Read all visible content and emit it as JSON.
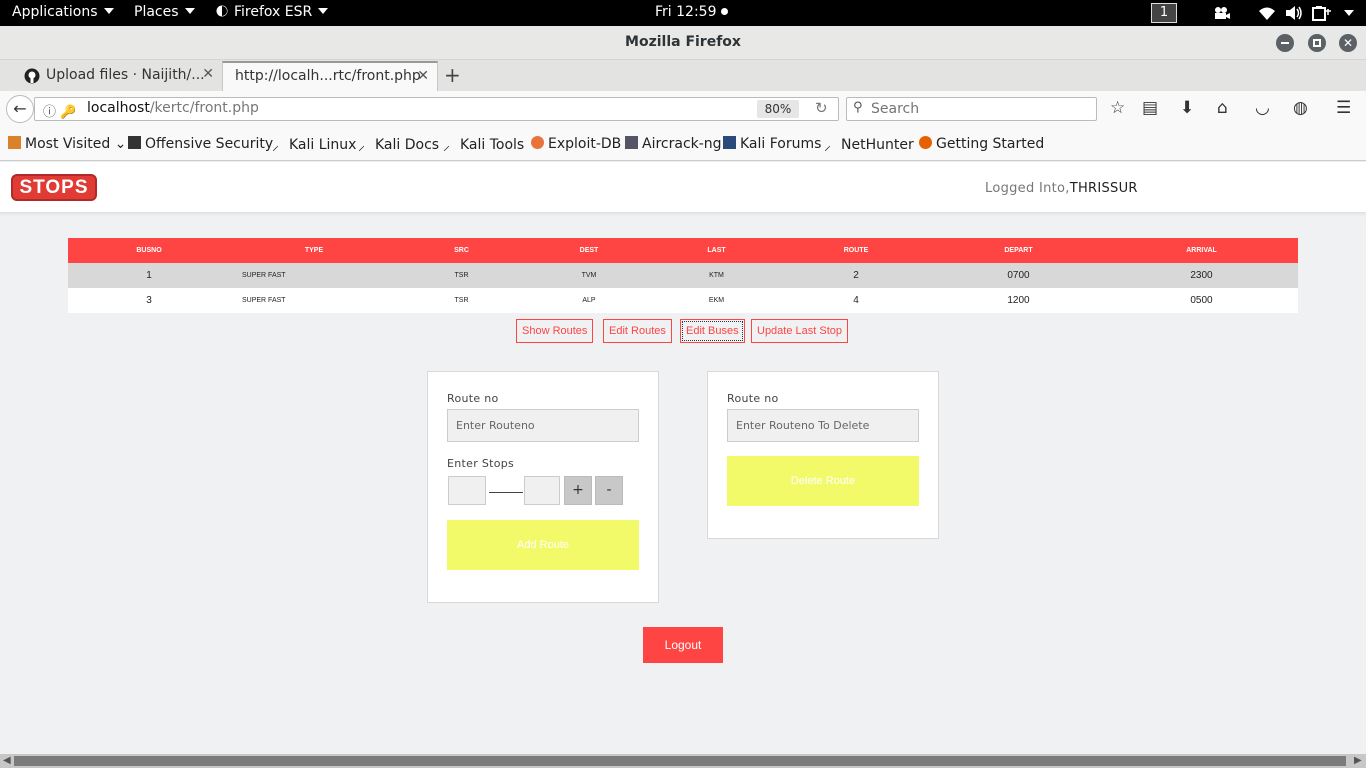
{
  "os_topbar": {
    "applications": "Applications",
    "places": "Places",
    "firefox_menu": "Firefox ESR",
    "clock": "Fri 12:59",
    "workspace": "1"
  },
  "window": {
    "title": "Mozilla Firefox"
  },
  "tabs": [
    {
      "label": "Upload files · Naijith/...",
      "active": false
    },
    {
      "label": "http://localh...rtc/front.php",
      "active": true
    }
  ],
  "urlbar": {
    "host": "localhost",
    "path": "/kertc/front.php",
    "zoom": "80%"
  },
  "searchbar": {
    "placeholder": "Search"
  },
  "bookmarks": [
    {
      "label": "Most Visited",
      "icon": "folder-icon"
    },
    {
      "label": "Offensive Security",
      "icon": "offsec-icon"
    },
    {
      "label": "Kali Linux",
      "icon": "kali-dragon-icon"
    },
    {
      "label": "Kali Docs",
      "icon": "kali-dragon-icon"
    },
    {
      "label": "Kali Tools",
      "icon": "kali-dragon-icon"
    },
    {
      "label": "Exploit-DB",
      "icon": "exploitdb-icon"
    },
    {
      "label": "Aircrack-ng",
      "icon": "aircrack-icon"
    },
    {
      "label": "Kali Forums",
      "icon": "kali-forums-icon"
    },
    {
      "label": "NetHunter",
      "icon": "kali-dragon-icon"
    },
    {
      "label": "Getting Started",
      "icon": "firefox-icon"
    }
  ],
  "site": {
    "logo": "STOPS",
    "logged_prefix": "Logged Into,",
    "logged_user": "THRISSUR"
  },
  "bus_table": {
    "headers": [
      "BUSNO",
      "TYPE",
      "SRC",
      "DEST",
      "LAST",
      "ROUTE",
      "DEPART",
      "ARRIVAL"
    ],
    "rows": [
      [
        "1",
        "SUPER FAST",
        "TSR",
        "TVM",
        "KTM",
        "2",
        "0700",
        "2300"
      ],
      [
        "3",
        "SUPER FAST",
        "TSR",
        "ALP",
        "EKM",
        "4",
        "1200",
        "0500"
      ]
    ]
  },
  "nav_buttons": [
    "Show Routes",
    "Edit Routes",
    "Edit Buses",
    "Update Last Stop"
  ],
  "add_form": {
    "route_label": "Route no",
    "route_placeholder": "Enter Routeno",
    "stops_label": "Enter Stops",
    "plus": "+",
    "minus": "-",
    "submit": "Add Route"
  },
  "delete_form": {
    "route_label": "Route no",
    "route_placeholder": "Enter Routeno To Delete",
    "submit": "Delete Route"
  },
  "logout": "Logout",
  "colors": {
    "accent_red": "#ff4444",
    "yellow_button": "#f2fa6a"
  }
}
